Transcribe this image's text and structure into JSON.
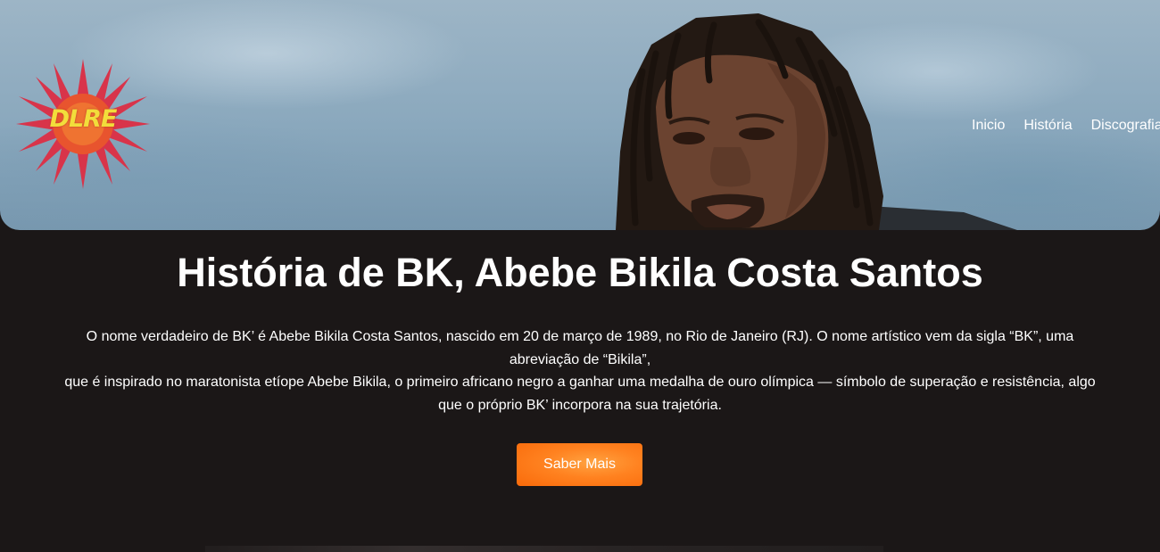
{
  "logo": {
    "text": "DLRE"
  },
  "nav": {
    "items": [
      {
        "label": "Inicio"
      },
      {
        "label": "História"
      },
      {
        "label": "Discografia"
      }
    ]
  },
  "hero": {
    "title": "História de BK, Abebe Bikila Costa Santos",
    "paragraph_lines": [
      "O nome verdadeiro de BK’ é Abebe Bikila Costa Santos, nascido em 20 de março de 1989, no Rio de Janeiro (RJ). O nome artístico vem da sigla “BK”, uma",
      "abreviação de “Bikila”,",
      "que é inspirado no maratonista etíope Abebe Bikila, o primeiro africano negro a ganhar uma medalha de ouro olímpica — símbolo de superação e resistência, algo",
      "que o próprio BK’ incorpora na sua trajetória."
    ],
    "cta_label": "Saber Mais"
  },
  "colors": {
    "background": "#1b1717",
    "accent": "#ff8220",
    "sky": "#8aa8bd",
    "logo_yellow": "#f2dd3b",
    "logo_red": "#d8344a"
  }
}
